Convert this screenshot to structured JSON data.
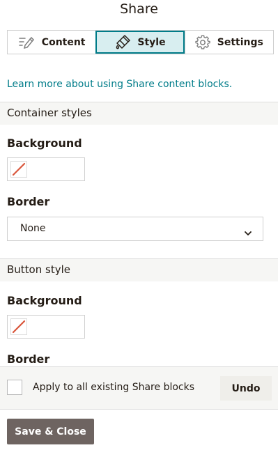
{
  "header": {
    "title": "Share"
  },
  "tabs": [
    {
      "label": "Content",
      "icon": "edit-icon",
      "active": false
    },
    {
      "label": "Style",
      "icon": "paint-icon",
      "active": true
    },
    {
      "label": "Settings",
      "icon": "gear-icon",
      "active": false
    }
  ],
  "learn_link": "Learn more about using Share content blocks.",
  "container_styles": {
    "heading": "Container styles",
    "background_label": "Background",
    "border_label": "Border",
    "border_value": "None"
  },
  "button_style": {
    "heading": "Button style",
    "background_label": "Background",
    "border_label": "Border"
  },
  "footer": {
    "apply_label": "Apply to all existing Share blocks",
    "undo_label": "Undo"
  },
  "save_label": "Save & Close",
  "colors": {
    "accent": "#007c89",
    "active_tab_bg": "#d8eef0",
    "save_button": "#6e6461",
    "no_color_slash": "#d9553b"
  }
}
